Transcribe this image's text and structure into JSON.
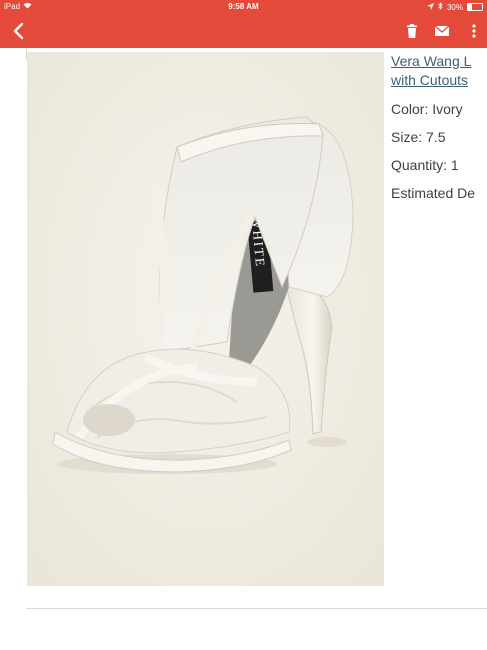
{
  "status_bar": {
    "device": "iPad",
    "time": "9:58 AM",
    "battery_text": "30%",
    "battery_level": 0.3
  },
  "toolbar": {
    "back_icon": "chevron-left-icon",
    "trash_icon": "trash-icon",
    "mail_icon": "mail-icon",
    "more_icon": "more-vertical-icon"
  },
  "product": {
    "title_line1": "Vera Wang L",
    "title_line2": "with Cutouts",
    "color": "Color: Ivory",
    "size": "Size: 7.5",
    "quantity": "Quantity: 1",
    "estimated": "Estimated De",
    "image_label": "WHITE"
  },
  "colors": {
    "accent": "#e5493a",
    "link": "#3b5f74",
    "text": "#404040"
  }
}
